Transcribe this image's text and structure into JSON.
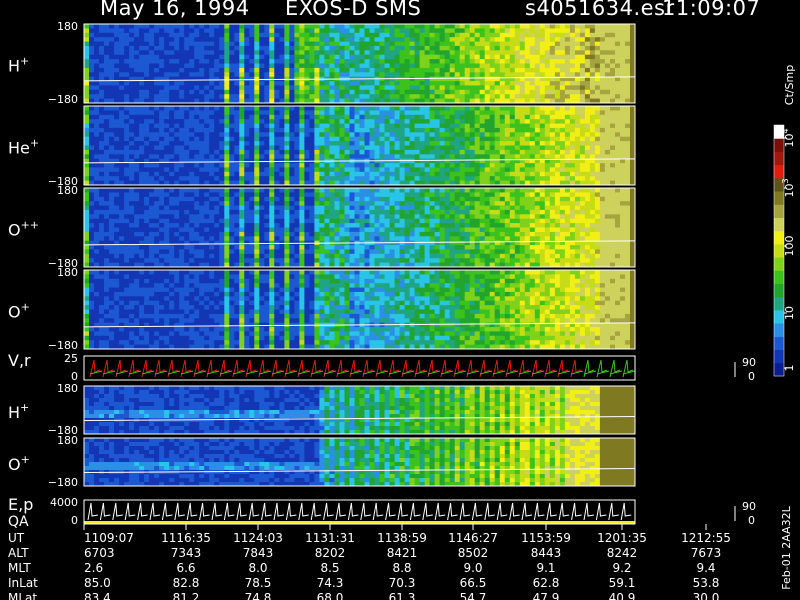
{
  "header": {
    "date": "May 16, 1994",
    "instrument": "EXOS-D SMS",
    "file": "s4051634.esr",
    "time": "11:09:07"
  },
  "chart_data": {
    "type": "heatmap",
    "title": "May 16, 1994   EXOS-D SMS",
    "time_ticks": [
      "1109:07",
      "1116:35",
      "1124:03",
      "1131:31",
      "1138:59",
      "1146:27",
      "1153:59",
      "1201:35",
      "1212:55"
    ],
    "panels": [
      {
        "label": "H",
        "sup": "+",
        "ymax": "180",
        "ymin": "−180",
        "kind": "ion"
      },
      {
        "label": "He",
        "sup": "+",
        "ymax": "",
        "ymin": "−180",
        "kind": "ion"
      },
      {
        "label": "O",
        "sup": "++",
        "ymax": "180",
        "ymin": "−180",
        "kind": "ion"
      },
      {
        "label": "O",
        "sup": "+",
        "ymax": "180",
        "ymin": "−180",
        "kind": "ion"
      },
      {
        "label": "V,r",
        "sup": "",
        "ymax": "25",
        "ymin": "0",
        "kind": "vr",
        "right_top": "90",
        "right_bottom": "0"
      },
      {
        "label": "H",
        "sup": "+",
        "ymax": "180",
        "ymin": "−180",
        "kind": "ion2"
      },
      {
        "label": "O",
        "sup": "+",
        "ymax": "180",
        "ymin": "−180",
        "kind": "ion2"
      },
      {
        "label": "E,p",
        "sup": "",
        "label2": "QA",
        "ymax": "4000",
        "ymin": "0",
        "kind": "ep",
        "right_top": "90",
        "right_bottom": "0"
      }
    ],
    "colorbar": {
      "label": "Ct/Smp",
      "ticks": [
        "1",
        "10",
        "100",
        "10^3",
        "10^4"
      ],
      "colors": [
        "#0c1e8e",
        "#1236b4",
        "#1c58d2",
        "#2b8fe6",
        "#29c4e6",
        "#1fa583",
        "#22a52e",
        "#3cc21c",
        "#7ed21a",
        "#c6dc17",
        "#f2ef16",
        "#cdd25c",
        "#a6a43f",
        "#7f7a22",
        "#5f5216",
        "#e01e10",
        "#a1180c",
        "#7a0f08",
        "#ffffff"
      ]
    },
    "ephemeris": {
      "rows": [
        {
          "label": "UT",
          "values": [
            "1109:07",
            "1116:35",
            "1124:03",
            "1131:31",
            "1138:59",
            "1146:27",
            "1153:59",
            "1201:35",
            "1212:55"
          ]
        },
        {
          "label": "ALT",
          "values": [
            "6703",
            "7343",
            "7843",
            "8202",
            "8421",
            "8502",
            "8443",
            "8242",
            "7673"
          ]
        },
        {
          "label": "MLT",
          "values": [
            "2.6",
            "6.6",
            "8.0",
            "8.5",
            "8.8",
            "9.0",
            "9.1",
            "9.2",
            "9.4"
          ]
        },
        {
          "label": "InLat",
          "values": [
            "85.0",
            "82.8",
            "78.5",
            "74.3",
            "70.3",
            "66.5",
            "62.8",
            "59.1",
            "53.8"
          ]
        },
        {
          "label": "MLat",
          "values": [
            "83.4",
            "81.2",
            "74.8",
            "68.0",
            "61.3",
            "54.7",
            "47.9",
            "40.9",
            "30.0"
          ]
        }
      ]
    },
    "side_note": "Feb-01 2AA32L"
  }
}
